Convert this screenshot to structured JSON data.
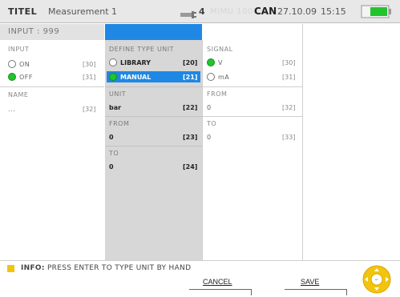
{
  "statusbar": {
    "title_label": "TITEL",
    "title_value": "Measurement 1",
    "connection_number": "4",
    "faded_text": "MIMU 1000",
    "can_label": "CAN",
    "date": "27.10.09",
    "time": "15:15",
    "battery_icon": "battery-icon",
    "plug_icon": "plug-icon",
    "battery_color": "#22c42e"
  },
  "input_header": "INPUT : 999",
  "left_col": {
    "input_title": "INPUT",
    "options": [
      {
        "label": "ON",
        "code": "[30]",
        "selected": false
      },
      {
        "label": "OFF",
        "code": "[31]",
        "selected": true
      }
    ],
    "name_title": "NAME",
    "name_value": "...",
    "name_code": "[32]"
  },
  "mid_col": {
    "define_title": "DEFINE TYPE UNIT",
    "options": [
      {
        "label": "LIBRARY",
        "code": "[20]",
        "selected": false
      },
      {
        "label": "MANUAL",
        "code": "[21]",
        "selected": true
      }
    ],
    "unit_title": "UNIT",
    "unit_value": "bar",
    "unit_code": "[22]",
    "from_title": "FROM",
    "from_value": "0",
    "from_code": "[23]",
    "to_title": "TO",
    "to_value": "0",
    "to_code": "[24]"
  },
  "right_col": {
    "signal_title": "SIGNAL",
    "options": [
      {
        "label": "V",
        "code": "[30]",
        "selected": true
      },
      {
        "label": "mA",
        "code": "[31]",
        "selected": false
      }
    ],
    "from_title": "FROM",
    "from_value": "0",
    "from_code": "[32]",
    "to_title": "TO",
    "to_value": "0",
    "to_code": "[33]"
  },
  "footer": {
    "info_prefix": "INFO:",
    "info_text": "PRESS ENTER TO TYPE UNIT BY HAND",
    "cancel_label": "CANCEL",
    "save_label": "SAVE",
    "info_icon": "info-icon",
    "nav_icon": "navigation-ring-icon",
    "accent_color": "#f2c40d",
    "selection_color": "#1f88e4"
  }
}
